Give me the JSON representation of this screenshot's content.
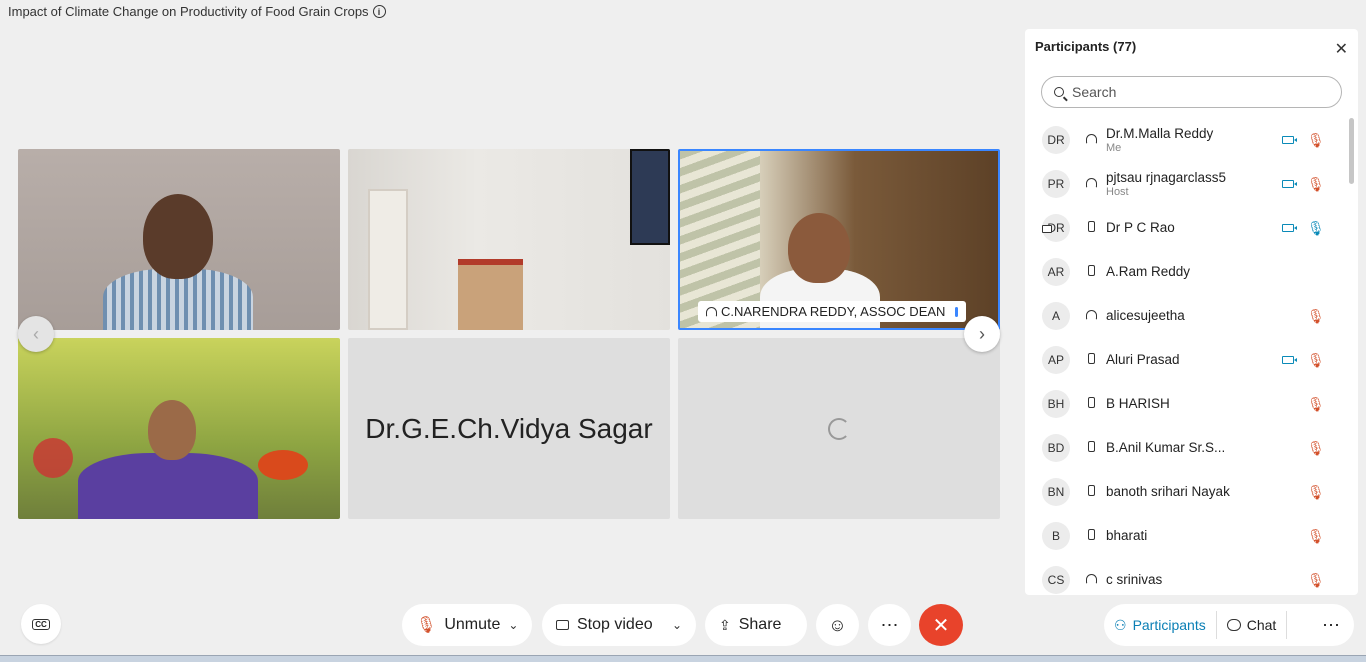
{
  "meeting": {
    "title": "Impact of Climate Change on Productivity of Food Grain Crops"
  },
  "video_tiles": {
    "speaker_tag": "C.NARENDRA REDDY, ASSOC DEAN",
    "name_tile": "Dr.G.E.Ch.Vidya Sagar"
  },
  "panel": {
    "title": "Participants (77)",
    "search_placeholder": "Search",
    "participants": [
      {
        "initials": "DR",
        "name": "Dr.M.Malla Reddy",
        "role": "Me",
        "device": "headset-icon",
        "video": true,
        "muted": true
      },
      {
        "initials": "PR",
        "name": "pjtsau rjnagarclass5",
        "role": "Host",
        "device": "headset-icon",
        "video": true,
        "muted": true
      },
      {
        "initials": "DR",
        "name": "Dr P C Rao",
        "role": "",
        "device": "phone-icon",
        "video": true,
        "muted": false
      },
      {
        "initials": "AR",
        "name": "A.Ram Reddy",
        "role": "",
        "device": "phone-icon",
        "video": false,
        "muted": false
      },
      {
        "initials": "A",
        "name": "alicesujeetha",
        "role": "",
        "device": "headset-icon",
        "video": false,
        "muted": true
      },
      {
        "initials": "AP",
        "name": "Aluri Prasad",
        "role": "",
        "device": "phone-icon",
        "video": true,
        "muted": true
      },
      {
        "initials": "BH",
        "name": "B HARISH",
        "role": "",
        "device": "phone-icon",
        "video": false,
        "muted": true
      },
      {
        "initials": "BD",
        "name": "B.Anil Kumar Sr.S...",
        "role": "",
        "device": "phone-icon",
        "video": false,
        "muted": true
      },
      {
        "initials": "BN",
        "name": "banoth srihari Nayak",
        "role": "",
        "device": "phone-icon",
        "video": false,
        "muted": true
      },
      {
        "initials": "B",
        "name": "bharati",
        "role": "",
        "device": "phone-icon",
        "video": false,
        "muted": true
      },
      {
        "initials": "CS",
        "name": "c srinivas",
        "role": "",
        "device": "headset-icon",
        "video": false,
        "muted": true
      }
    ]
  },
  "controls": {
    "unmute": "Unmute",
    "stop_video": "Stop video",
    "share": "Share"
  },
  "side_tabs": {
    "participants": "Participants",
    "chat": "Chat"
  },
  "colors": {
    "accent": "#0a7fb5",
    "end_call": "#e8432b",
    "muted": "#d3512c"
  }
}
